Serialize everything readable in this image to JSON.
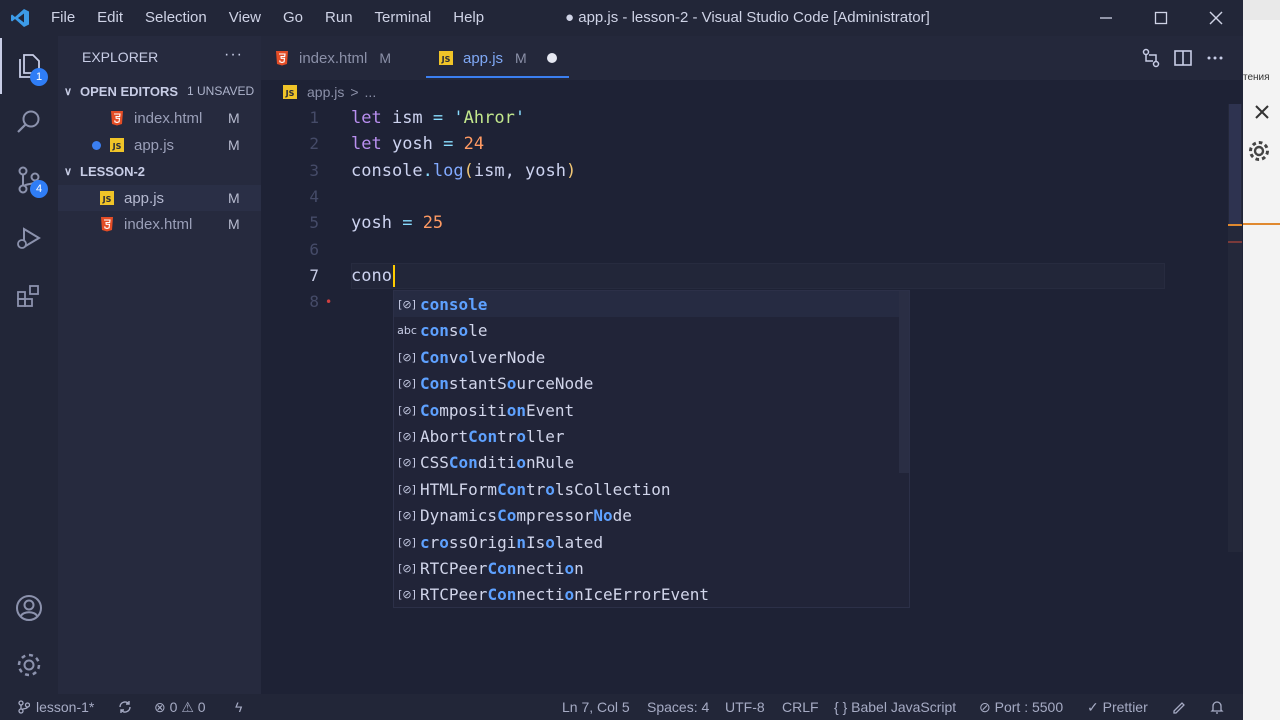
{
  "menu": [
    "File",
    "Edit",
    "Selection",
    "View",
    "Go",
    "Run",
    "Terminal",
    "Help"
  ],
  "window_title": "● app.js - lesson-2 - Visual Studio Code [Administrator]",
  "activity": {
    "explorer_badge": "1",
    "scm_badge": "4"
  },
  "sidebar": {
    "title": "EXPLORER",
    "more": "···",
    "open_editors": {
      "label": "OPEN EDITORS",
      "unsaved": "1 UNSAVED",
      "files": [
        {
          "name": "index.html",
          "mark": "M"
        },
        {
          "name": "app.js",
          "mark": "M"
        }
      ]
    },
    "folder": {
      "label": "LESSON-2",
      "files": [
        {
          "name": "app.js",
          "mark": "M"
        },
        {
          "name": "index.html",
          "mark": "M"
        }
      ]
    }
  },
  "tabs": [
    {
      "name": "index.html",
      "mark": "M"
    },
    {
      "name": "app.js",
      "mark": "M"
    }
  ],
  "breadcrumb": {
    "file": "app.js",
    "sep": ">",
    "rest": "..."
  },
  "editor": {
    "line_numbers": [
      "1",
      "2",
      "3",
      "4",
      "5",
      "6",
      "7",
      "8"
    ],
    "typed": "cono"
  },
  "suggestions": [
    {
      "kind": "[⊘]",
      "text": "console"
    },
    {
      "kind": "abc",
      "text": "console"
    },
    {
      "kind": "[⊘]",
      "text": "ConvolverNode"
    },
    {
      "kind": "[⊘]",
      "text": "ConstantSourceNode"
    },
    {
      "kind": "[⊘]",
      "text": "CompositionEvent"
    },
    {
      "kind": "[⊘]",
      "text": "AbortController"
    },
    {
      "kind": "[⊘]",
      "text": "CSSConditionRule"
    },
    {
      "kind": "[⊘]",
      "text": "HTMLFormControlsCollection"
    },
    {
      "kind": "[⊘]",
      "text": "DynamicsCompressorNode"
    },
    {
      "kind": "[⊘]",
      "text": "crossOriginIsolated"
    },
    {
      "kind": "[⊘]",
      "text": "RTCPeerConnection"
    },
    {
      "kind": "[⊘]",
      "text": "RTCPeerConnectionIceErrorEvent"
    }
  ],
  "status": {
    "branch": "lesson-1*",
    "errors": "0",
    "warnings": "0",
    "position": "Ln 7, Col 5",
    "spaces": "Spaces: 4",
    "encoding": "UTF-8",
    "eol": "CRLF",
    "language": "Babel JavaScript",
    "port": "Port : 5500",
    "formatter": "Prettier"
  },
  "right_pane": {
    "partial_text": "тения"
  },
  "colors": {
    "accent": "#3b7ff1",
    "js_icon": "#f0c428",
    "html_icon": "#e44d26",
    "cursor": "#ffcc00"
  }
}
